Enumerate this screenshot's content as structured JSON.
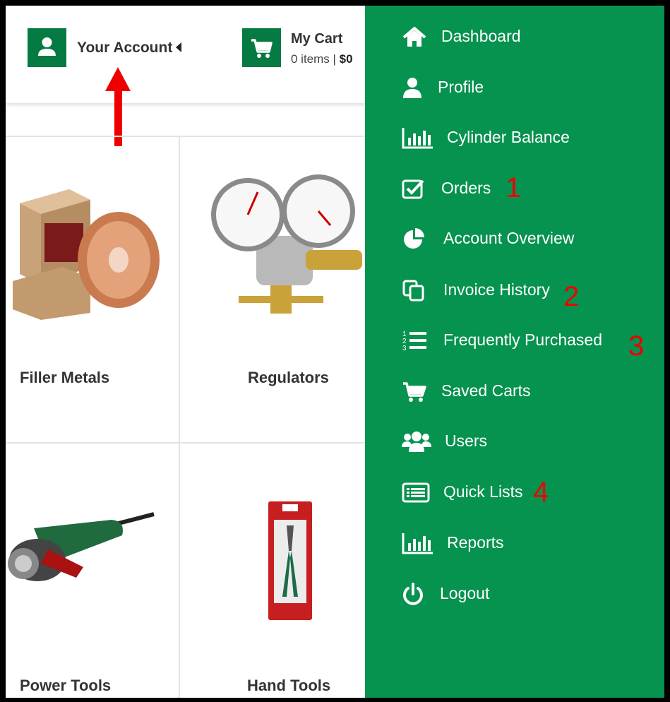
{
  "header": {
    "account_label": "Your Account",
    "cart_title": "My Cart",
    "cart_items": "0 items |",
    "cart_total": "$0"
  },
  "products": [
    {
      "name": "Filler Metals"
    },
    {
      "name": "Regulators"
    },
    {
      "name": "Power Tools"
    },
    {
      "name": "Hand Tools"
    }
  ],
  "menu": {
    "items": [
      {
        "label": "Dashboard",
        "icon": "home-icon"
      },
      {
        "label": "Profile",
        "icon": "user-icon"
      },
      {
        "label": "Cylinder Balance",
        "icon": "bar-chart-icon"
      },
      {
        "label": "Orders",
        "icon": "check-square-icon"
      },
      {
        "label": "Account Overview",
        "icon": "pie-chart-icon"
      },
      {
        "label": "Invoice History",
        "icon": "copy-icon"
      },
      {
        "label": "Frequently Purchased",
        "icon": "numbered-list-icon"
      },
      {
        "label": "Saved Carts",
        "icon": "cart-icon"
      },
      {
        "label": "Users",
        "icon": "users-icon"
      },
      {
        "label": "Quick Lists",
        "icon": "list-alt-icon"
      },
      {
        "label": "Reports",
        "icon": "bar-chart-icon"
      },
      {
        "label": "Logout",
        "icon": "power-icon"
      }
    ]
  },
  "annotations": [
    "1",
    "2",
    "3",
    "4"
  ],
  "colors": {
    "brand_green": "#06924f",
    "button_green": "#057a43",
    "annotation_red": "#e00000"
  }
}
